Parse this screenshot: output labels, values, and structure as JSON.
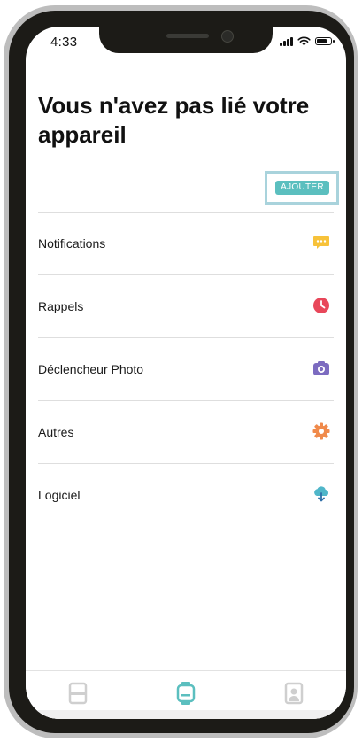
{
  "status_bar": {
    "time": "4:33"
  },
  "main": {
    "title": "Vous n'avez pas lié votre appareil",
    "add_button_label": "AJOUTER"
  },
  "menu": {
    "items": [
      {
        "label": "Notifications",
        "icon": "chat-bubble-icon",
        "color": "#f7c23a"
      },
      {
        "label": "Rappels",
        "icon": "clock-icon",
        "color": "#e8475a"
      },
      {
        "label": "Déclencheur Photo",
        "icon": "camera-icon",
        "color": "#7c6bc0"
      },
      {
        "label": "Autres",
        "icon": "gear-icon",
        "color": "#f08a4b"
      },
      {
        "label": "Logiciel",
        "icon": "cloud-download-icon",
        "color": "#4fb6c9"
      }
    ]
  },
  "tab_bar": {
    "tabs": [
      {
        "name": "dashboard",
        "icon": "dashboard-icon",
        "color": "#cfcfcf",
        "active": false
      },
      {
        "name": "device",
        "icon": "watch-icon",
        "color": "#5bbfbf",
        "active": true
      },
      {
        "name": "profile",
        "icon": "person-icon",
        "color": "#cfcfcf",
        "active": false
      }
    ]
  },
  "colors": {
    "accent": "#5bbfbf",
    "highlight_border": "#a9d3dc"
  }
}
